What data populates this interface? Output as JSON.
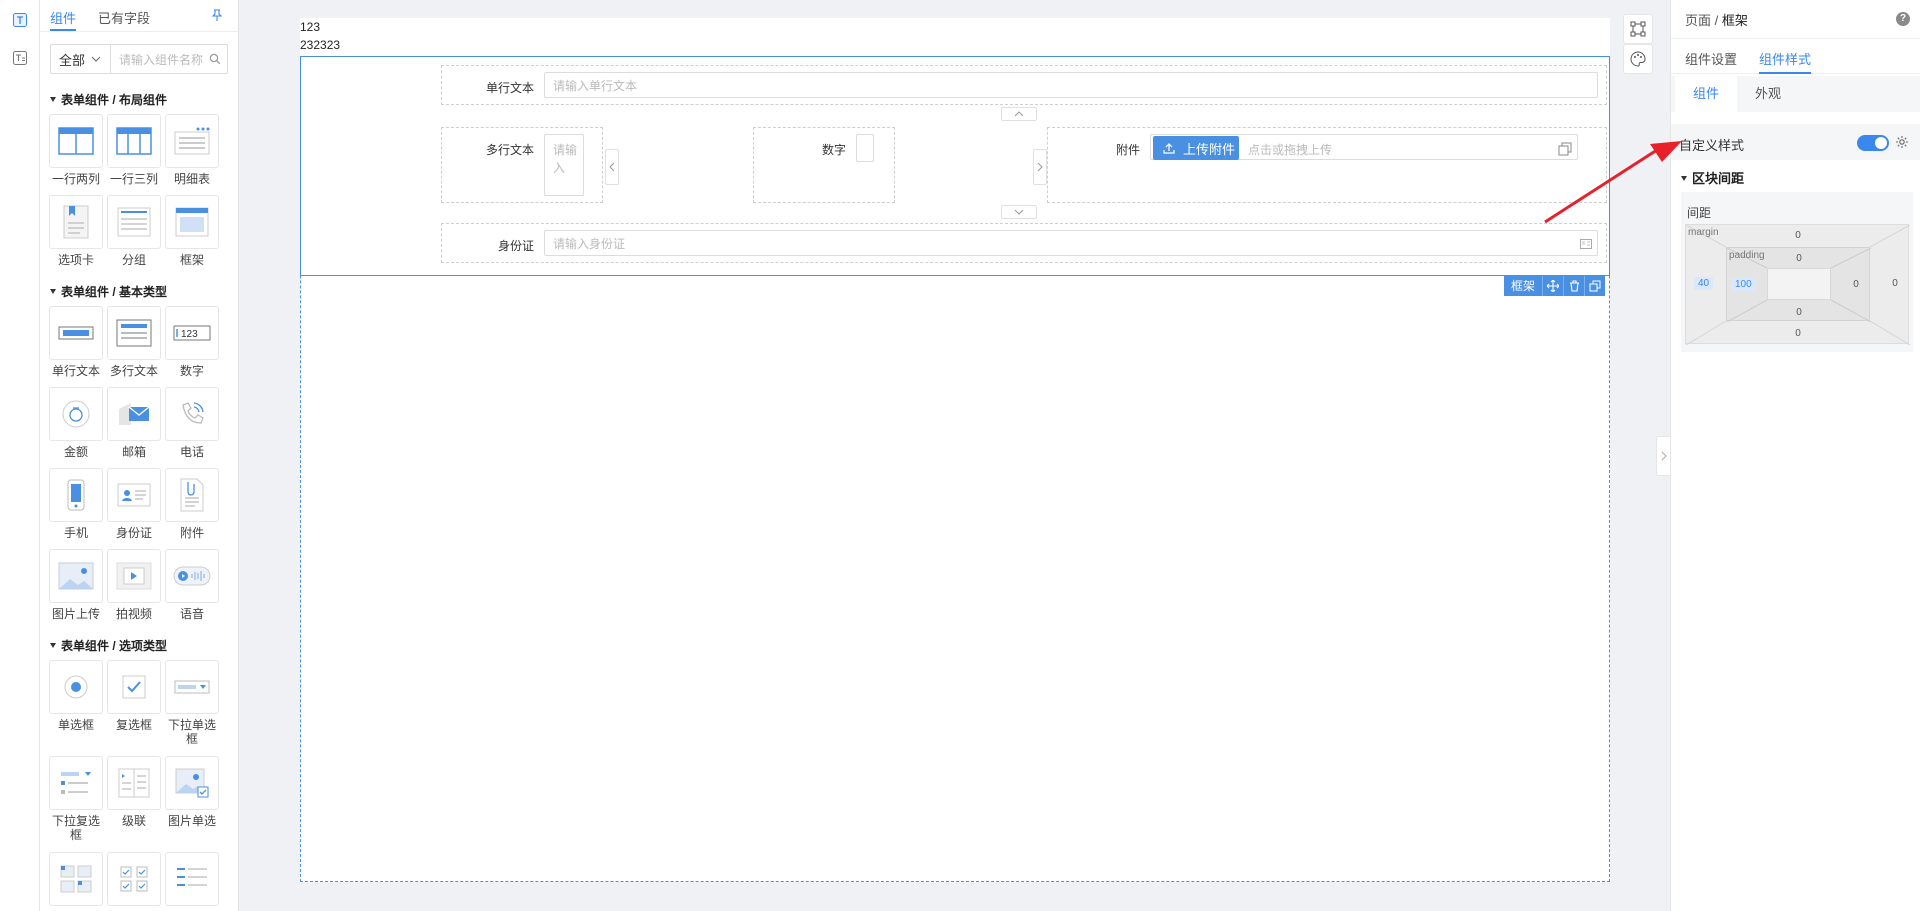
{
  "left_panel": {
    "tabs": [
      "组件",
      "已有字段"
    ],
    "filter": {
      "selected": "全部",
      "placeholder": "请输入组件名称"
    },
    "sections": [
      {
        "title": "表单组件 / 布局组件",
        "items": [
          "一行两列",
          "一行三列",
          "明细表",
          "选项卡",
          "分组",
          "框架"
        ]
      },
      {
        "title": "表单组件 / 基本类型",
        "items": [
          "单行文本",
          "多行文本",
          "数字",
          "金额",
          "邮箱",
          "电话",
          "手机",
          "身份证",
          "附件",
          "图片上传",
          "拍视频",
          "语音"
        ]
      },
      {
        "title": "表单组件 / 选项类型",
        "items": [
          "单选框",
          "复选框",
          "下拉单选框",
          "下拉复选框",
          "级联",
          "图片单选",
          "",
          "",
          ""
        ]
      }
    ]
  },
  "canvas": {
    "text_lines": [
      "123",
      "232323"
    ],
    "fields": {
      "single_text": {
        "label": "单行文本",
        "placeholder": "请输入单行文本"
      },
      "multi_text": {
        "label": "多行文本",
        "placeholder": "请输入"
      },
      "number": {
        "label": "数字"
      },
      "attachment": {
        "label": "附件",
        "button": "上传附件",
        "hint": "点击或拖拽上传"
      },
      "id_card": {
        "label": "身份证",
        "placeholder": "请输入身份证"
      }
    },
    "frame_tag": "框架"
  },
  "right_panel": {
    "breadcrumb": {
      "parent": "页面",
      "sep": "/",
      "current": "框架"
    },
    "help": "?",
    "tabs": [
      "组件设置",
      "组件样式"
    ],
    "subtabs": [
      "组件",
      "外观"
    ],
    "custom_style_label": "自定义样式",
    "custom_style_on": true,
    "area_title": "区块间距",
    "spacing_label": "间距",
    "box_model": {
      "margin_label": "margin",
      "padding_label": "padding",
      "margin": {
        "top": "0",
        "right": "0",
        "bottom": "0",
        "left": "40"
      },
      "padding": {
        "top": "0",
        "right": "0",
        "bottom": "0",
        "left": "100"
      }
    }
  },
  "colors": {
    "accent": "#3a87f0",
    "annotation_arrow": "#e8202a"
  }
}
